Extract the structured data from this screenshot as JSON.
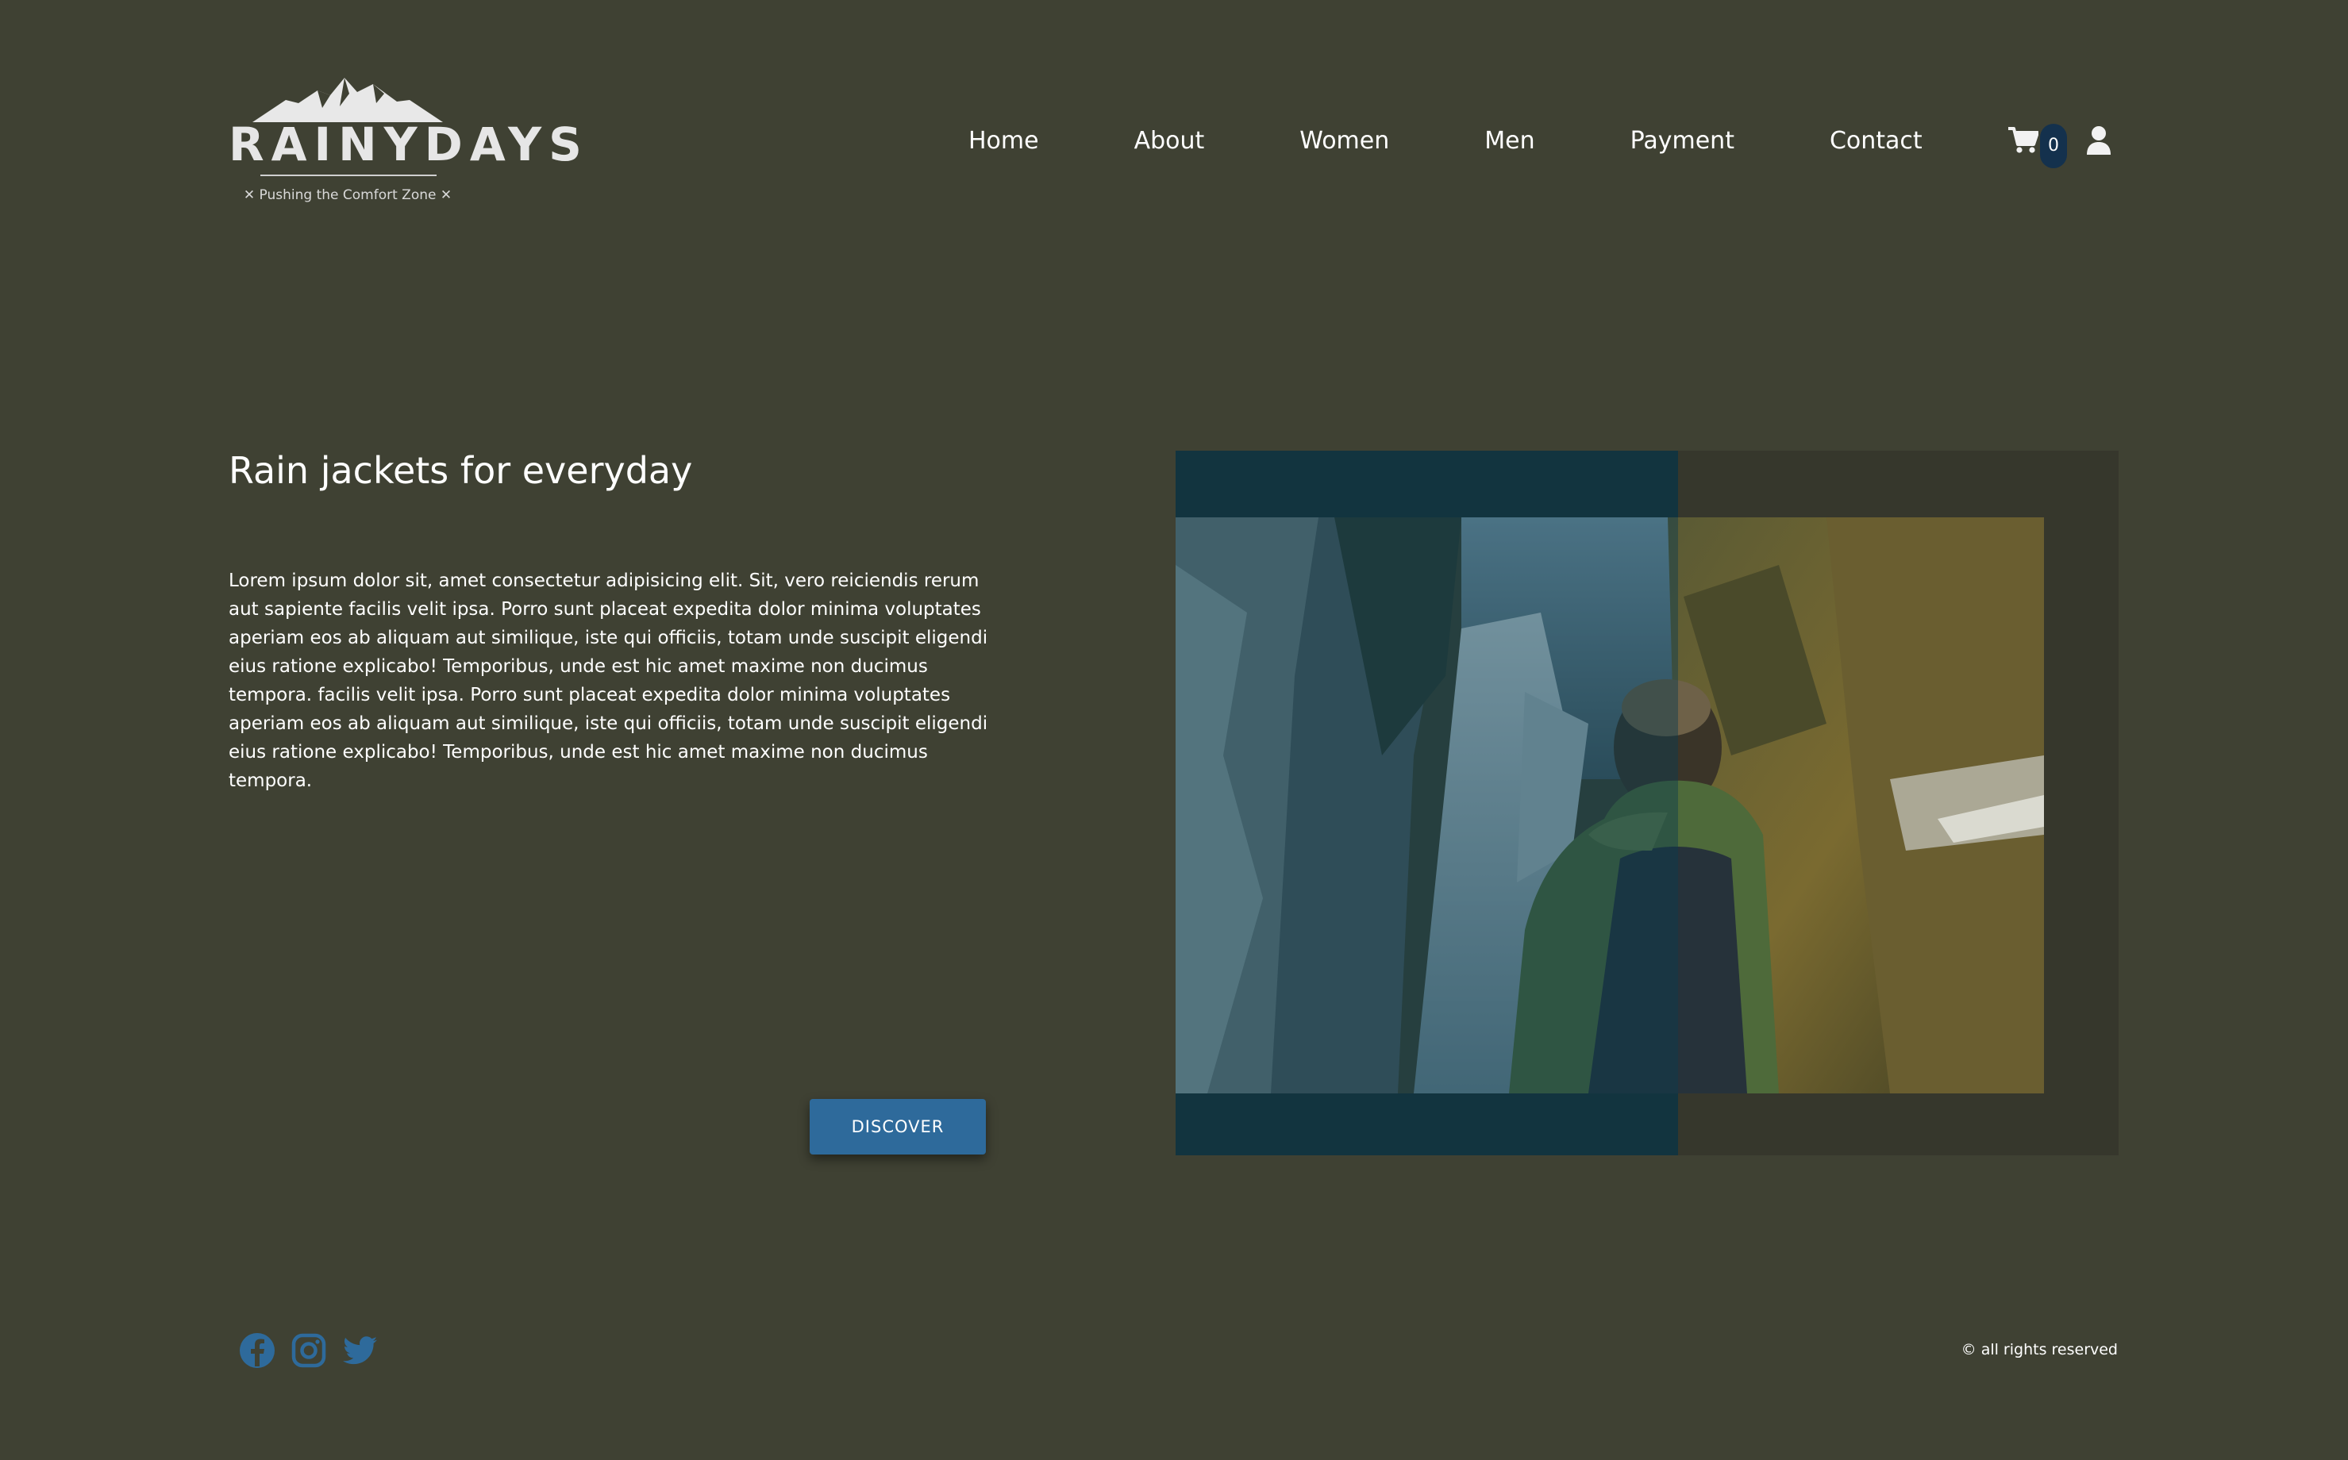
{
  "header": {
    "logo": {
      "brand": "RAINYDAYS",
      "tagline": "✕ Pushing the Comfort Zone ✕"
    },
    "nav": [
      {
        "label": "Home"
      },
      {
        "label": "About"
      },
      {
        "label": "Women"
      },
      {
        "label": "Men"
      },
      {
        "label": "Payment"
      },
      {
        "label": "Contact"
      }
    ],
    "cart": {
      "icon": "cart-icon",
      "count": "0"
    },
    "user": {
      "icon": "user-icon"
    }
  },
  "hero": {
    "title": "Rain jackets for everyday",
    "body": "Lorem ipsum dolor sit, amet consectetur adipisicing elit. Sit, vero reiciendis rerum aut sapiente facilis velit ipsa. Porro sunt placeat expedita dolor minima voluptates aperiam eos ab aliquam aut similique, iste qui officiis, totam unde suscipit eligendi eius ratione explicabo! Temporibus, unde est hic amet maxime non ducimus tempora. facilis velit ipsa. Porro sunt placeat expedita dolor minima voluptates aperiam eos ab aliquam aut similique, iste qui officiis, totam unde suscipit eligendi eius ratione explicabo! Temporibus, unde est hic amet maxime non ducimus tempora.",
    "cta_label": "DISCOVER"
  },
  "footer": {
    "socials": [
      "facebook-icon",
      "instagram-icon",
      "twitter-icon"
    ],
    "copyright": "© all rights reserved"
  },
  "colors": {
    "background": "#3f4133",
    "accent": "#2e6a9b",
    "cart_badge": "#14314d",
    "hero_teal": "#12343f",
    "hero_dark": "#36372c"
  }
}
